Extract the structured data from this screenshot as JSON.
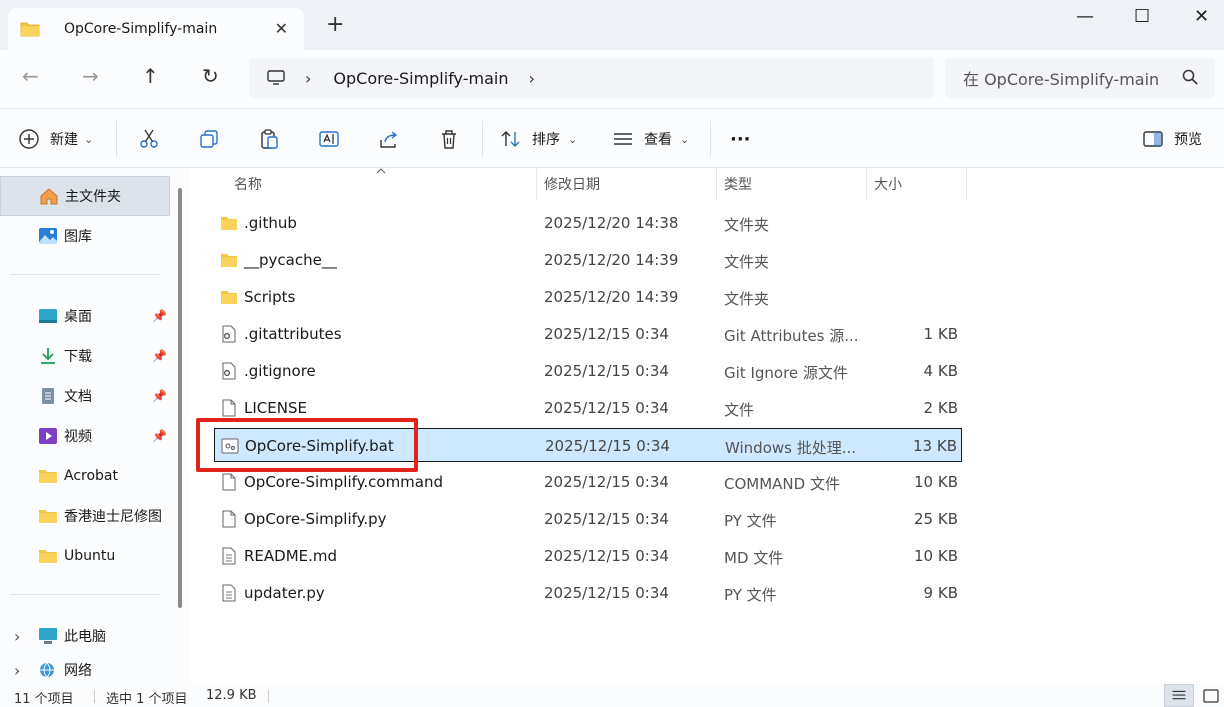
{
  "titlebar": {
    "tab_title": "OpCore-Simplify-main",
    "close": "✕",
    "new_tab": "+",
    "minimize": "—",
    "maximize": "☐",
    "close_window": "✕"
  },
  "nav": {
    "back": "←",
    "forward": "→",
    "up": "↑",
    "refresh": "↻"
  },
  "address": {
    "separator": "›",
    "folder": "OpCore-Simplify-main",
    "trail": "›"
  },
  "search": {
    "placeholder": "在 OpCore-Simplify-main"
  },
  "toolbar": {
    "new_label": "新建",
    "sort_label": "排序",
    "view_label": "查看",
    "more": "···",
    "preview_label": "预览",
    "dropdown": "⌄"
  },
  "sidebar": {
    "home": "主文件夹",
    "gallery": "图库",
    "pinned": [
      {
        "label": "桌面",
        "icon": "desktop-icon"
      },
      {
        "label": "下载",
        "icon": "download-icon"
      },
      {
        "label": "文档",
        "icon": "document-icon"
      },
      {
        "label": "视频",
        "icon": "video-icon"
      }
    ],
    "folders": [
      "Acrobat",
      "香港迪士尼修图",
      "Ubuntu"
    ],
    "this_pc": "此电脑",
    "network": "网络",
    "pin_glyph": "📌",
    "expand": "›"
  },
  "columns": {
    "name": "名称",
    "date": "修改日期",
    "type": "类型",
    "size": "大小"
  },
  "files": [
    {
      "name": ".github",
      "date": "2025/12/20 14:38",
      "type": "文件夹",
      "size": "",
      "icon": "folder-icon"
    },
    {
      "name": "__pycache__",
      "date": "2025/12/20 14:39",
      "type": "文件夹",
      "size": "",
      "icon": "folder-icon"
    },
    {
      "name": "Scripts",
      "date": "2025/12/20 14:39",
      "type": "文件夹",
      "size": "",
      "icon": "folder-icon"
    },
    {
      "name": ".gitattributes",
      "date": "2025/12/15 0:34",
      "type": "Git Attributes 源...",
      "size": "1 KB",
      "icon": "config-file-icon"
    },
    {
      "name": ".gitignore",
      "date": "2025/12/15 0:34",
      "type": "Git Ignore 源文件",
      "size": "4 KB",
      "icon": "config-file-icon"
    },
    {
      "name": "LICENSE",
      "date": "2025/12/15 0:34",
      "type": "文件",
      "size": "2 KB",
      "icon": "blank-file-icon"
    },
    {
      "name": "OpCore-Simplify.bat",
      "date": "2025/12/15 0:34",
      "type": "Windows 批处理...",
      "size": "13 KB",
      "icon": "batch-file-icon"
    },
    {
      "name": "OpCore-Simplify.command",
      "date": "2025/12/15 0:34",
      "type": "COMMAND 文件",
      "size": "10 KB",
      "icon": "blank-file-icon"
    },
    {
      "name": "OpCore-Simplify.py",
      "date": "2025/12/15 0:34",
      "type": "PY 文件",
      "size": "25 KB",
      "icon": "blank-file-icon"
    },
    {
      "name": "README.md",
      "date": "2025/12/15 0:34",
      "type": "MD 文件",
      "size": "10 KB",
      "icon": "text-file-icon"
    },
    {
      "name": "updater.py",
      "date": "2025/12/15 0:34",
      "type": "PY 文件",
      "size": "9 KB",
      "icon": "text-file-icon"
    }
  ],
  "status": {
    "count": "11 个项目",
    "selected": "选中 1 个项目",
    "selected_size": "12.9 KB"
  },
  "colors": {
    "highlight": "#e0231b",
    "selection": "#cde8ff",
    "folder": "#f4c542"
  }
}
